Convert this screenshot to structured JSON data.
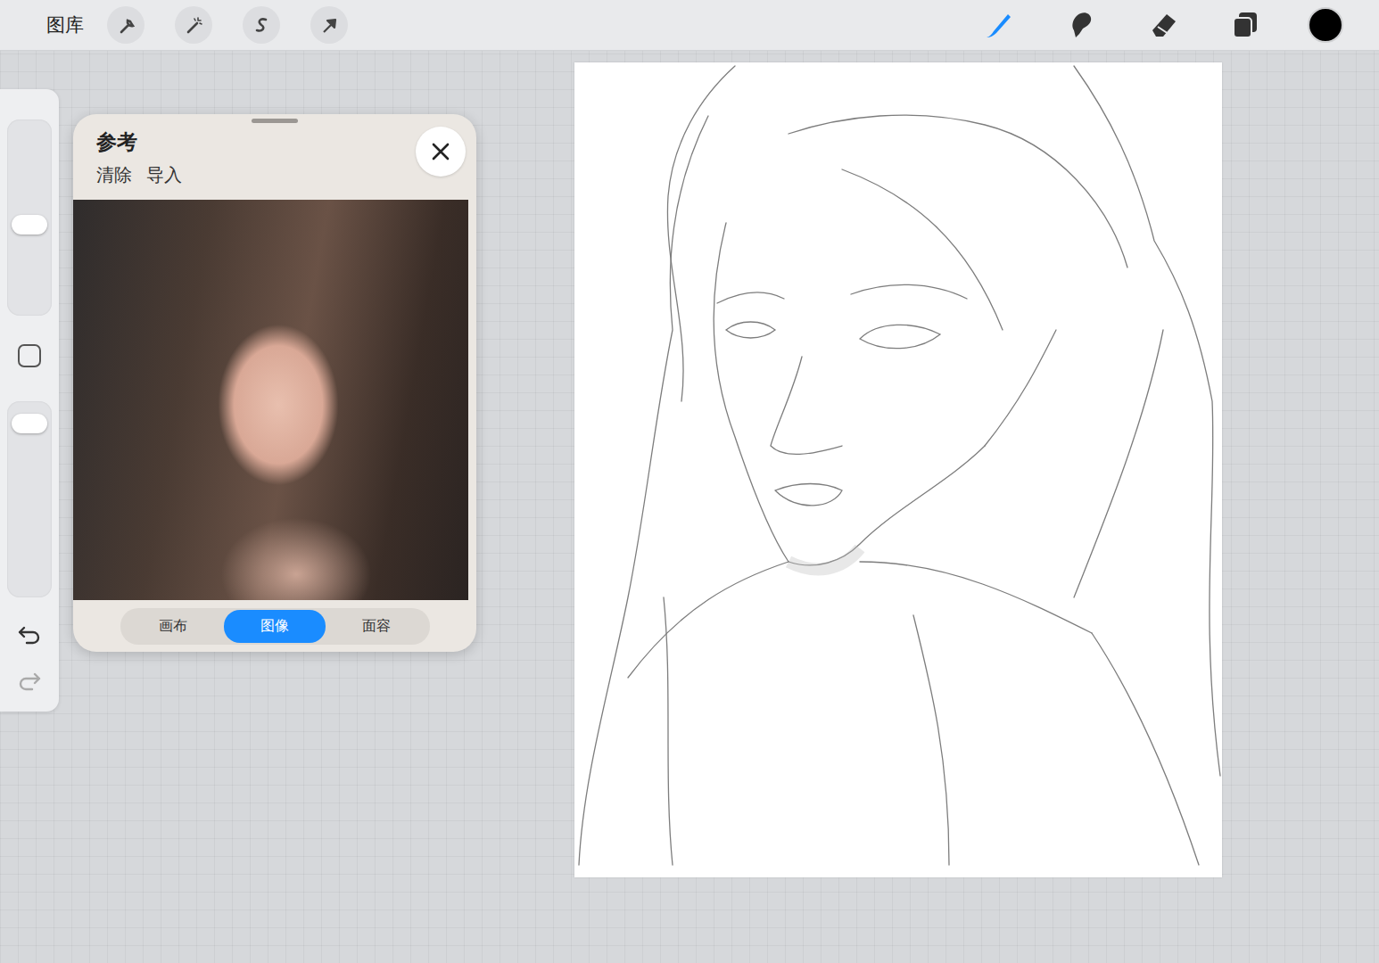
{
  "toolbar": {
    "gallery": "图库",
    "tools": [
      {
        "name": "brush",
        "selected": true
      },
      {
        "name": "smudge",
        "selected": false
      },
      {
        "name": "eraser",
        "selected": false
      }
    ],
    "brush_color": "#000000"
  },
  "sidebar": {
    "size_level": 0.46,
    "opacity_level": 0.93
  },
  "reference": {
    "title": "参考",
    "actions": [
      "清除",
      "导入"
    ],
    "tabs": [
      {
        "label": "画布",
        "selected": false
      },
      {
        "label": "图像",
        "selected": true
      },
      {
        "label": "面容",
        "selected": false
      }
    ]
  }
}
